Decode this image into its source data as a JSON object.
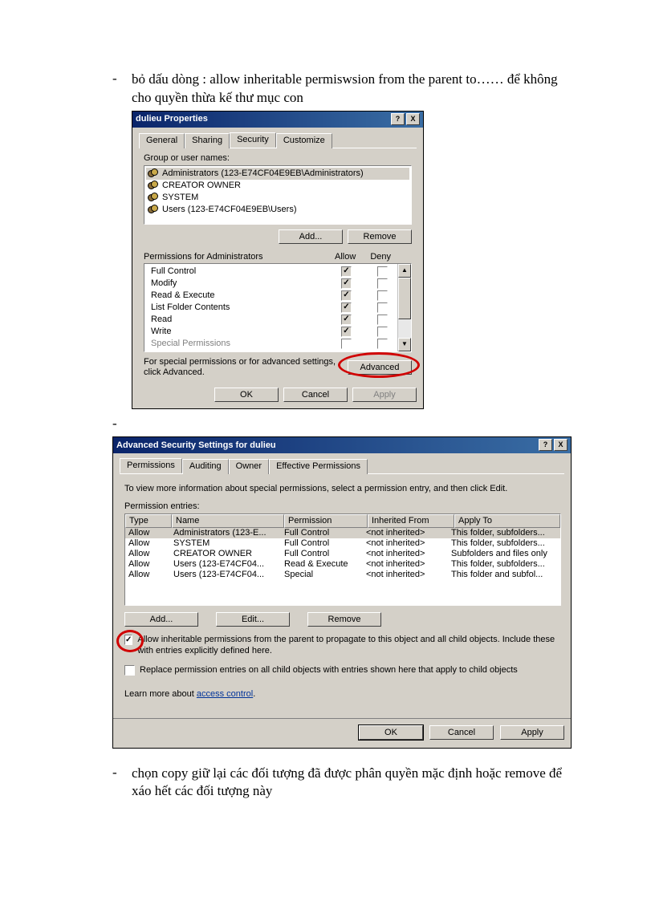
{
  "bullet1": "bỏ dấu dòng :  allow  inheritable  permiswsion from the parent to……  để không cho quyền thừa kế thư mục con",
  "bullet2": "chọn copy giữ lại  các đối tượng đã được phân quyền mặc định hoặc remove để xáo hết các đối tượng này",
  "lonedash": "-",
  "dialog1": {
    "title": "dulieu Properties",
    "ctrl_help": "?",
    "ctrl_close": "X",
    "tabs": {
      "general": "General",
      "sharing": "Sharing",
      "security": "Security",
      "customize": "Customize"
    },
    "groupLabel": "Group or user names:",
    "groups": [
      "Administrators (123-E74CF04E9EB\\Administrators)",
      "CREATOR OWNER",
      "SYSTEM",
      "Users (123-E74CF04E9EB\\Users)"
    ],
    "addBtn": "Add...",
    "removeBtn": "Remove",
    "permForLabel": "Permissions for Administrators",
    "allowLabel": "Allow",
    "denyLabel": "Deny",
    "perms": [
      {
        "name": "Full Control",
        "allow": true,
        "deny": false
      },
      {
        "name": "Modify",
        "allow": true,
        "deny": false
      },
      {
        "name": "Read & Execute",
        "allow": true,
        "deny": false
      },
      {
        "name": "List Folder Contents",
        "allow": true,
        "deny": false
      },
      {
        "name": "Read",
        "allow": true,
        "deny": false
      },
      {
        "name": "Write",
        "allow": true,
        "deny": false
      },
      {
        "name": "Special Permissions",
        "allow": false,
        "deny": false
      }
    ],
    "advText": "For special permissions or for advanced settings, click Advanced.",
    "advBtn": "Advanced",
    "ok": "OK",
    "cancel": "Cancel",
    "apply": "Apply"
  },
  "dialog2": {
    "title": "Advanced Security Settings for dulieu",
    "ctrl_help": "?",
    "ctrl_close": "X",
    "tabs": {
      "permissions": "Permissions",
      "auditing": "Auditing",
      "owner": "Owner",
      "effective": "Effective Permissions"
    },
    "info": "To view more information about special permissions, select a permission entry, and then click Edit.",
    "entriesLabel": "Permission entries:",
    "cols": {
      "type": "Type",
      "name": "Name",
      "perm": "Permission",
      "inh": "Inherited From",
      "apply": "Apply To"
    },
    "rows": [
      {
        "type": "Allow",
        "name": "Administrators (123-E...",
        "perm": "Full Control",
        "inh": "<not inherited>",
        "apply": "This folder, subfolders..."
      },
      {
        "type": "Allow",
        "name": "SYSTEM",
        "perm": "Full Control",
        "inh": "<not inherited>",
        "apply": "This folder, subfolders..."
      },
      {
        "type": "Allow",
        "name": "CREATOR OWNER",
        "perm": "Full Control",
        "inh": "<not inherited>",
        "apply": "Subfolders and files only"
      },
      {
        "type": "Allow",
        "name": "Users (123-E74CF04...",
        "perm": "Read & Execute",
        "inh": "<not inherited>",
        "apply": "This folder, subfolders..."
      },
      {
        "type": "Allow",
        "name": "Users (123-E74CF04...",
        "perm": "Special",
        "inh": "<not inherited>",
        "apply": "This folder and subfol..."
      }
    ],
    "addBtn": "Add...",
    "editBtn": "Edit...",
    "removeBtn": "Remove",
    "inheritCheck": "Allow inheritable permissions from the parent to propagate to this object and all child objects. Include these with entries explicitly defined here.",
    "replaceCheck": "Replace permission entries on all child objects with entries shown here that apply to child objects",
    "learnMore": "Learn more about ",
    "accessControl": "access control",
    "ok": "OK",
    "cancel": "Cancel",
    "apply": "Apply"
  }
}
